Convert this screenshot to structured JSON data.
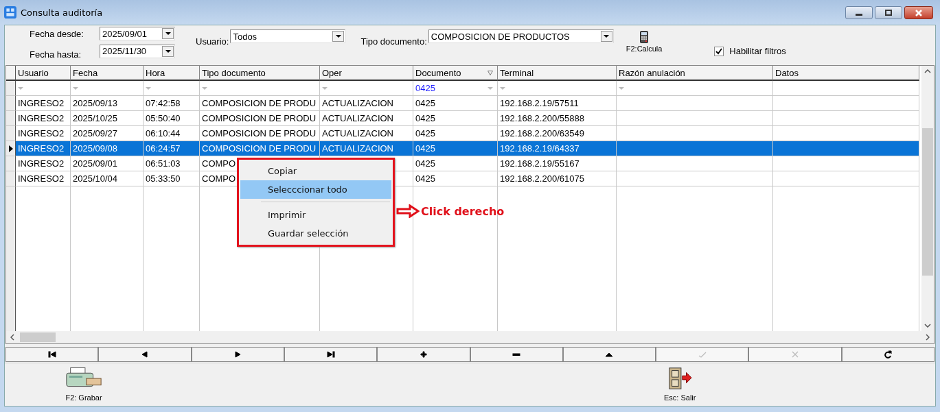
{
  "window": {
    "title": "Consulta auditoría"
  },
  "filters": {
    "fecha_desde": {
      "label": "Fecha desde:",
      "value": "2025/09/01"
    },
    "fecha_hasta": {
      "label": "Fecha hasta:",
      "value": "2025/11/30"
    },
    "usuario": {
      "label": "Usuario:",
      "value": "Todos"
    },
    "tipo_documento": {
      "label": "Tipo documento:",
      "value": "COMPOSICION DE PRODUCTOS"
    },
    "calcula": {
      "label": "F2:Calcula"
    },
    "habilitar": {
      "label": "Habilitar filtros",
      "checked": true
    }
  },
  "table": {
    "columns": [
      {
        "label": "Usuario",
        "filtered": false
      },
      {
        "label": "Fecha",
        "filtered": false
      },
      {
        "label": "Hora",
        "filtered": false
      },
      {
        "label": "Tipo documento",
        "filtered": false
      },
      {
        "label": "Oper",
        "filtered": false
      },
      {
        "label": "Documento",
        "filtered": true,
        "filter_value": "0425"
      },
      {
        "label": "Terminal",
        "filtered": false
      },
      {
        "label": "Razón anulación",
        "filtered": false
      },
      {
        "label": "Datos",
        "filtered": false
      }
    ],
    "rows": [
      {
        "selected": false,
        "cells": [
          "INGRESO2",
          "2025/09/13",
          "07:42:58",
          "COMPOSICION DE PRODU",
          "ACTUALIZACION",
          "0425",
          "192.168.2.19/57511",
          null,
          null
        ]
      },
      {
        "selected": false,
        "cells": [
          "INGRESO2",
          "2025/10/25",
          "05:50:40",
          "COMPOSICION DE PRODU",
          "ACTUALIZACION",
          "0425",
          "192.168.2.200/55888",
          null,
          null
        ]
      },
      {
        "selected": false,
        "cells": [
          "INGRESO2",
          "2025/09/27",
          "06:10:44",
          "COMPOSICION DE PRODU",
          "ACTUALIZACION",
          "0425",
          "192.168.2.200/63549",
          null,
          null
        ]
      },
      {
        "selected": true,
        "cells": [
          "INGRESO2",
          "2025/09/08",
          "06:24:57",
          "COMPOSICION DE PRODU",
          "ACTUALIZACION",
          "0425",
          "192.168.2.19/64337",
          null,
          null
        ]
      },
      {
        "selected": false,
        "cells": [
          "INGRESO2",
          "2025/09/01",
          "06:51:03",
          "COMPO",
          null,
          "0425",
          "192.168.2.19/55167",
          null,
          null
        ]
      },
      {
        "selected": false,
        "cells": [
          "INGRESO2",
          "2025/10/04",
          "05:33:50",
          "COMPO",
          null,
          "0425",
          "192.168.2.200/61075",
          null,
          null
        ]
      }
    ]
  },
  "context_menu": {
    "items": [
      {
        "kind": "item",
        "label": "Copiar",
        "selected": false
      },
      {
        "kind": "item",
        "label": "Selecccionar todo",
        "selected": true
      },
      {
        "kind": "separator"
      },
      {
        "kind": "item",
        "label": "Imprimir",
        "selected": false
      },
      {
        "kind": "item",
        "label": "Guardar selección",
        "selected": false
      }
    ]
  },
  "annotation": {
    "label": "Click derecho"
  },
  "navigator": [
    {
      "kind": "first",
      "disabled": false
    },
    {
      "kind": "prev",
      "disabled": false
    },
    {
      "kind": "next",
      "disabled": false
    },
    {
      "kind": "last",
      "disabled": false
    },
    {
      "kind": "insert",
      "disabled": false
    },
    {
      "kind": "delete",
      "disabled": false
    },
    {
      "kind": "edit",
      "disabled": false
    },
    {
      "kind": "post",
      "disabled": true
    },
    {
      "kind": "cancel",
      "disabled": true
    },
    {
      "kind": "refresh",
      "disabled": false
    }
  ],
  "footer_buttons": [
    {
      "kind": "printer",
      "label": "F2: Grabar"
    },
    {
      "kind": "exit",
      "label": "Esc: Salir"
    }
  ]
}
